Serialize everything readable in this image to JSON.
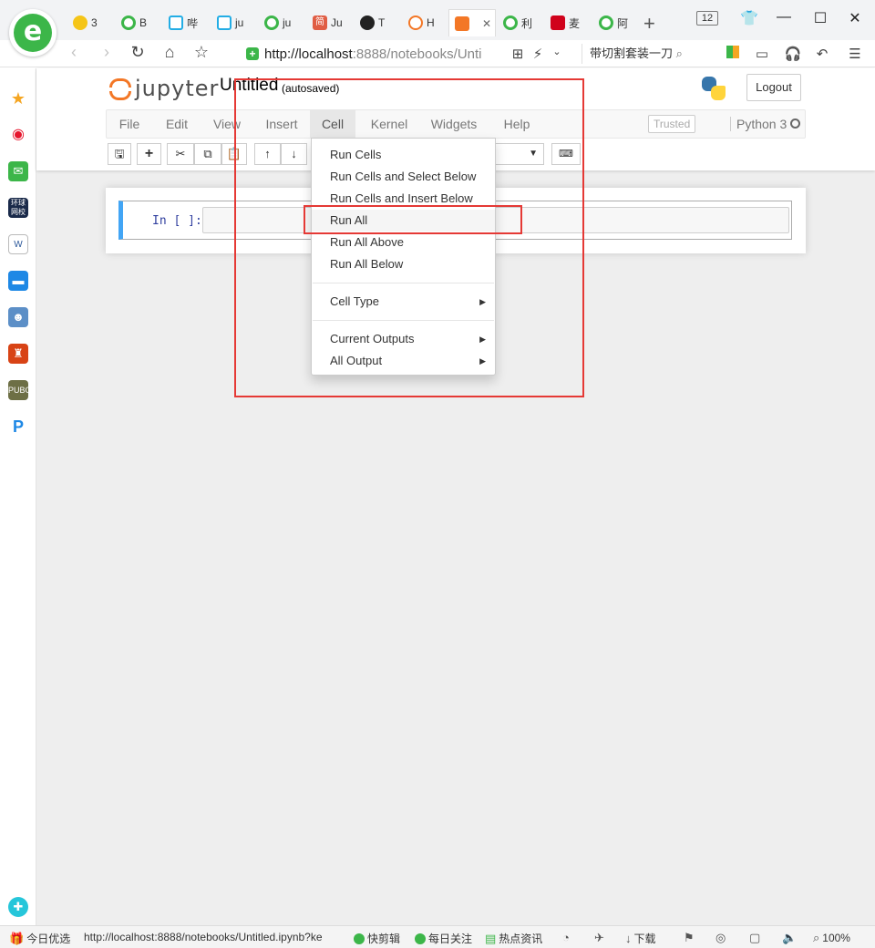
{
  "browser": {
    "tabs": [
      {
        "label": "3",
        "color": "#f5c518"
      },
      {
        "label": "B",
        "color": "#3cb649"
      },
      {
        "label": "哔",
        "color": "#23ade5"
      },
      {
        "label": "ju",
        "color": "#23ade5"
      },
      {
        "label": "ju",
        "color": "#3cb649"
      },
      {
        "label": "Ju",
        "color": "#e05d44"
      },
      {
        "label": "T",
        "color": "#222222"
      },
      {
        "label": "H",
        "color": "#f37726"
      },
      {
        "label": "",
        "color": "#f37726"
      },
      {
        "label": "利",
        "color": "#3cb649"
      },
      {
        "label": "麦",
        "color": "#d0021b"
      },
      {
        "label": "阿",
        "color": "#3cb649"
      }
    ],
    "active_tab_close": "✕",
    "new_tab": "+",
    "tab_count": "12",
    "url_host": "http://localhost",
    "url_rest": ":8888/notebooks/Unti",
    "search_text": "带切割套装一刀",
    "status_url": "http://localhost:8888/notebooks/Untitled.ipynb?ke",
    "status_items": [
      "今日优选",
      "快剪辑",
      "每日关注",
      "热点资讯",
      "下载",
      "100%"
    ]
  },
  "jupyter": {
    "logo_text": "jupyter",
    "notebook_title": "Untitled",
    "autosave_status": "(autosaved)",
    "logout_label": "Logout",
    "menus": [
      "File",
      "Edit",
      "View",
      "Insert",
      "Cell",
      "Kernel",
      "Widgets",
      "Help"
    ],
    "trusted_label": "Trusted",
    "kernel_name": "Python 3",
    "prompt": "In [ ]:"
  },
  "cell_menu": {
    "items": [
      {
        "label": "Run Cells",
        "submenu": false
      },
      {
        "label": "Run Cells and Select Below",
        "submenu": false
      },
      {
        "label": "Run Cells and Insert Below",
        "submenu": false
      },
      {
        "label": "Run All",
        "submenu": false,
        "highlighted": true
      },
      {
        "label": "Run All Above",
        "submenu": false
      },
      {
        "label": "Run All Below",
        "submenu": false
      },
      {
        "label": "Cell Type",
        "submenu": true
      },
      {
        "label": "Current Outputs",
        "submenu": true
      },
      {
        "label": "All Output",
        "submenu": true
      }
    ]
  },
  "colors": {
    "annotation": "#e53935",
    "jupyter_orange": "#f37726",
    "cell_selected": "#42a5f5"
  }
}
